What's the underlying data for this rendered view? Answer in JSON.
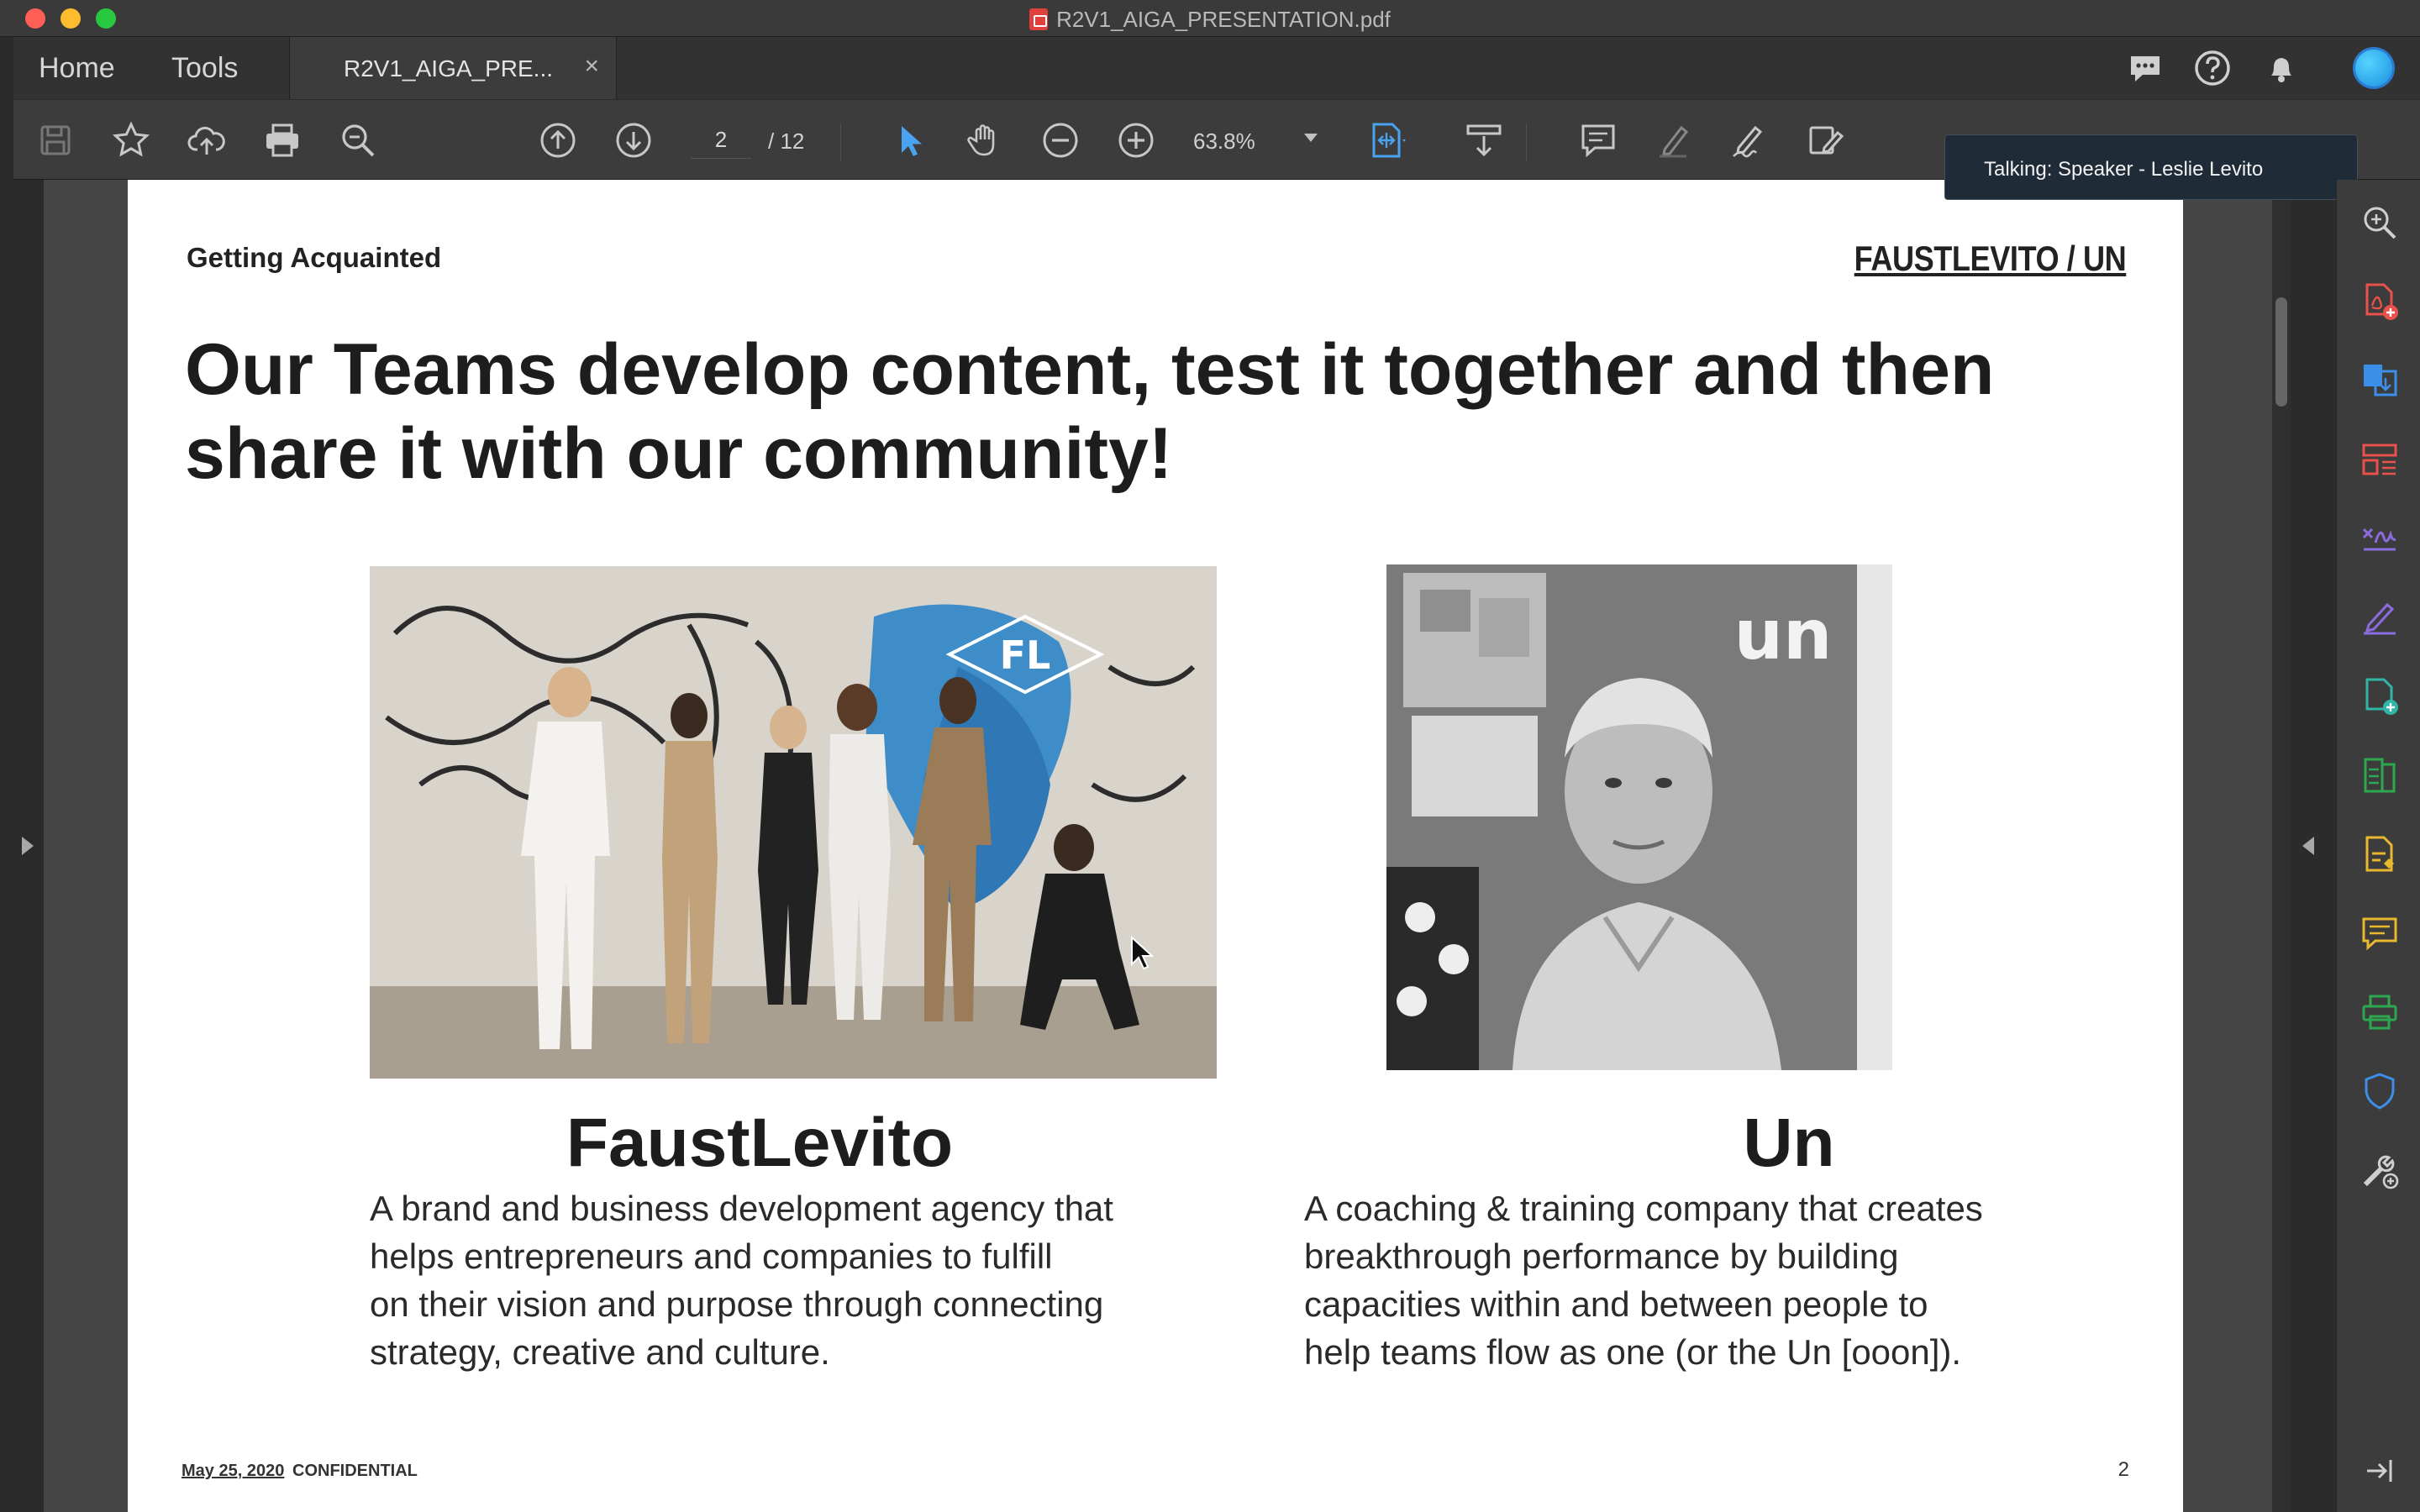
{
  "window": {
    "title": "R2V1_AIGA_PRESENTATION.pdf"
  },
  "nav": {
    "home": "Home",
    "tools": "Tools"
  },
  "tab": {
    "label": "R2V1_AIGA_PRE...",
    "close": "×"
  },
  "toolbar": {
    "page_current": "2",
    "page_total": "/ 12",
    "zoom": "63.8%"
  },
  "tooltip": {
    "text": "Talking: Speaker - Leslie Levito"
  },
  "slide": {
    "eyebrow": "Getting Acquainted",
    "brand": "FAUSTLEVITO / UN",
    "headline_line1": "Our Teams develop content, test it together and then",
    "headline_line2": "share it with our community!",
    "left": {
      "logo": "FL",
      "title": "FaustLevito",
      "body_lines": [
        "A brand and business development agency that",
        "helps entrepreneurs and companies to fulfill",
        "on their vision and purpose through connecting",
        "strategy, creative and culture."
      ]
    },
    "right": {
      "logo": "un",
      "title": "Un",
      "body_lines": [
        "A coaching & training company that creates",
        "breakthrough performance by building",
        "capacities within and between people to",
        "help teams flow as one (or the Un [ooon])."
      ]
    },
    "footer": {
      "date": "May 25, 2020",
      "confidential": "CONFIDENTIAL",
      "page": "2"
    }
  },
  "colors": {
    "accent_blue": "#4aa3f0",
    "tool_red": "#e9514b",
    "tool_blue": "#3c8fe8",
    "tool_purple": "#8c6bdf",
    "tool_teal": "#2fb6a6",
    "tool_yellow": "#e8b92f",
    "tool_green": "#2ea84f"
  },
  "icons": {
    "titlebar": [
      "pdf-file-icon"
    ],
    "tabbar_right": [
      "chat-icon",
      "help-icon",
      "bell-icon",
      "avatar"
    ],
    "toolbar": [
      "save-icon",
      "star-icon",
      "upload-cloud-icon",
      "print-icon",
      "zoom-search-icon",
      "prev-page-icon",
      "next-page-icon",
      "select-cursor-icon",
      "hand-icon",
      "zoom-out-icon",
      "zoom-in-icon",
      "fit-page-icon",
      "scroll-mode-icon",
      "comment-icon",
      "highlight-icon",
      "sign-icon",
      "edit-icon"
    ],
    "right_panel": [
      "zoom-icon",
      "create-pdf-icon",
      "export-pdf-icon",
      "organize-pages-icon",
      "fill-sign-icon",
      "edit-pdf-icon",
      "add-file-icon",
      "compress-icon",
      "scan-icon",
      "comment-icon",
      "print-production-icon",
      "protect-icon",
      "tools-icon",
      "panel-exit-icon"
    ]
  }
}
